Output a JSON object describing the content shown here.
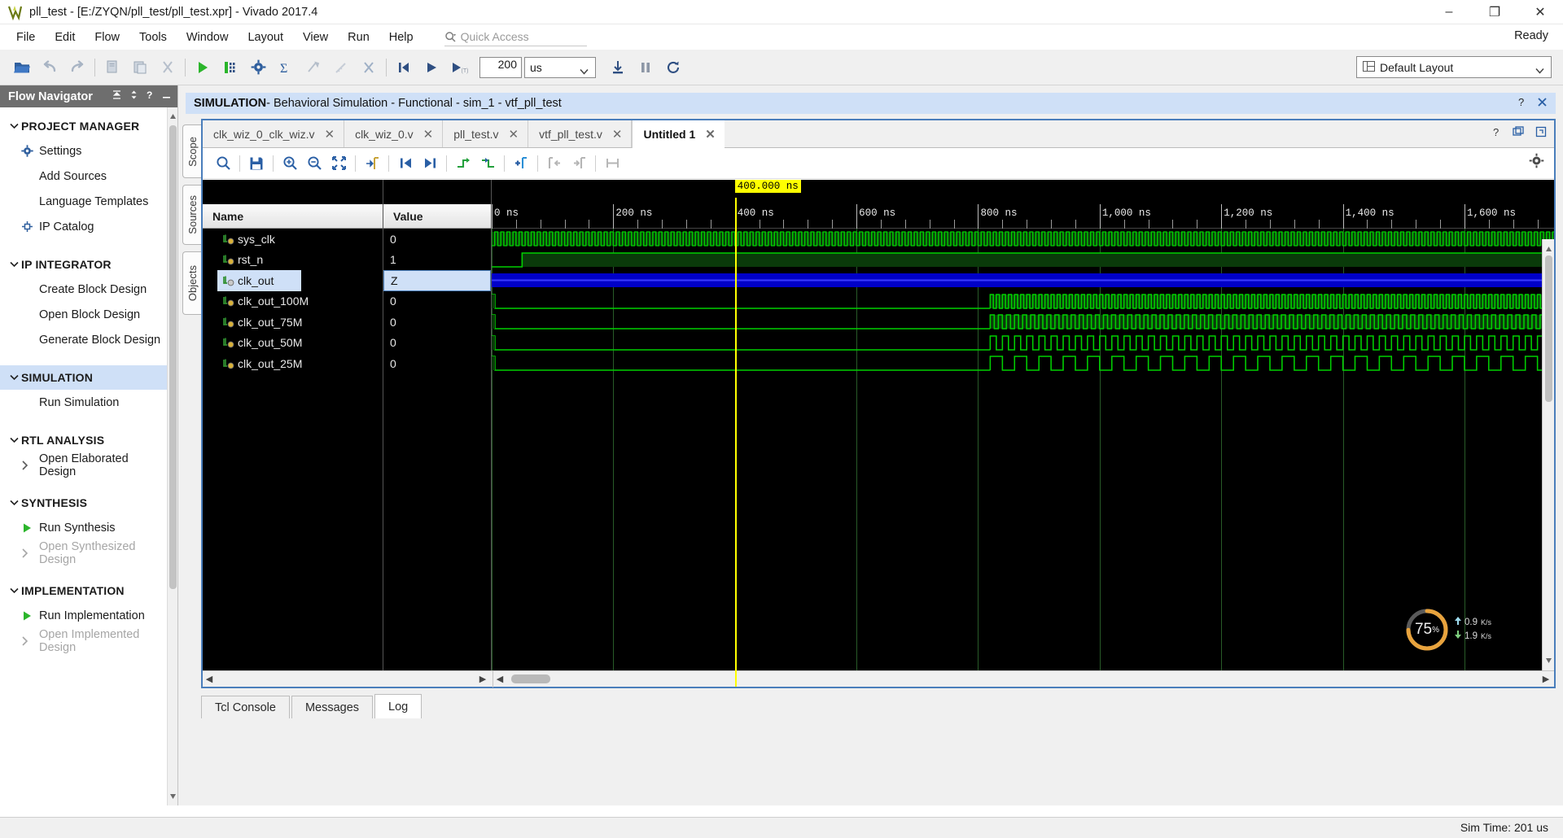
{
  "window": {
    "title": "pll_test - [E:/ZYQN/pll_test/pll_test.xpr] - Vivado 2017.4",
    "minimize": "–",
    "maximize": "❐",
    "close": "✕"
  },
  "menu": {
    "items": [
      {
        "label": "File"
      },
      {
        "label": "Edit"
      },
      {
        "label": "Flow"
      },
      {
        "label": "Tools"
      },
      {
        "label": "Window"
      },
      {
        "label": "Layout"
      },
      {
        "label": "View"
      },
      {
        "label": "Run"
      },
      {
        "label": "Help"
      }
    ],
    "quick_access_placeholder": "Quick Access",
    "ready_label": "Ready"
  },
  "toolbar": {
    "sim_time_value": "200",
    "sim_time_unit": "us",
    "layout_label": "Default Layout"
  },
  "flow_navigator": {
    "title": "Flow Navigator",
    "sections": [
      {
        "label": "PROJECT MANAGER",
        "active": false,
        "items": [
          {
            "label": "Settings",
            "icon": "gear-icon",
            "disabled": false,
            "arrow": false
          },
          {
            "label": "Add Sources",
            "icon": "none",
            "disabled": false,
            "arrow": false
          },
          {
            "label": "Language Templates",
            "icon": "none",
            "disabled": false,
            "arrow": false
          },
          {
            "label": "IP Catalog",
            "icon": "ip-icon",
            "disabled": false,
            "arrow": false
          }
        ]
      },
      {
        "label": "IP INTEGRATOR",
        "active": false,
        "items": [
          {
            "label": "Create Block Design",
            "icon": "none",
            "disabled": false,
            "arrow": false
          },
          {
            "label": "Open Block Design",
            "icon": "none",
            "disabled": false,
            "arrow": false
          },
          {
            "label": "Generate Block Design",
            "icon": "none",
            "disabled": false,
            "arrow": false
          }
        ]
      },
      {
        "label": "SIMULATION",
        "active": true,
        "items": [
          {
            "label": "Run Simulation",
            "icon": "none",
            "disabled": false,
            "arrow": false
          }
        ]
      },
      {
        "label": "RTL ANALYSIS",
        "active": false,
        "items": [
          {
            "label": "Open Elaborated Design",
            "icon": "none",
            "disabled": false,
            "arrow": true
          }
        ]
      },
      {
        "label": "SYNTHESIS",
        "active": false,
        "items": [
          {
            "label": "Run Synthesis",
            "icon": "play-icon",
            "disabled": false,
            "arrow": false
          },
          {
            "label": "Open Synthesized Design",
            "icon": "none",
            "disabled": true,
            "arrow": true
          }
        ]
      },
      {
        "label": "IMPLEMENTATION",
        "active": false,
        "items": [
          {
            "label": "Run Implementation",
            "icon": "play-icon",
            "disabled": false,
            "arrow": false
          },
          {
            "label": "Open Implemented Design",
            "icon": "none",
            "disabled": true,
            "arrow": true
          }
        ]
      }
    ]
  },
  "simulation": {
    "header_bold": "SIMULATION",
    "header_rest": " - Behavioral Simulation - Functional - sim_1 - vtf_pll_test",
    "side_tabs": [
      "Scope",
      "Sources",
      "Objects"
    ],
    "file_tabs": [
      {
        "label": "clk_wiz_0_clk_wiz.v",
        "active": false
      },
      {
        "label": "clk_wiz_0.v",
        "active": false
      },
      {
        "label": "pll_test.v",
        "active": false
      },
      {
        "label": "vtf_pll_test.v",
        "active": false
      },
      {
        "label": "Untitled 1",
        "active": true
      }
    ],
    "close_glyph": "✕",
    "columns": {
      "name": "Name",
      "value": "Value"
    },
    "signals": [
      {
        "name": "sys_clk",
        "value": "0",
        "selected": false,
        "wave": "clock",
        "period": 10,
        "start": 0,
        "color": "#00d000"
      },
      {
        "name": "rst_n",
        "value": "1",
        "selected": false,
        "wave": "reset",
        "rise_at": 50,
        "color": "#00d000"
      },
      {
        "name": "clk_out",
        "value": "Z",
        "selected": true,
        "wave": "highz",
        "color": "#0000ff"
      },
      {
        "name": "clk_out_100M",
        "value": "0",
        "selected": false,
        "wave": "gated",
        "period": 10,
        "lock_at": 820,
        "color": "#00d000"
      },
      {
        "name": "clk_out_75M",
        "value": "0",
        "selected": false,
        "wave": "gated",
        "period": 13.3,
        "lock_at": 820,
        "color": "#00d000"
      },
      {
        "name": "clk_out_50M",
        "value": "0",
        "selected": false,
        "wave": "gated",
        "period": 20,
        "lock_at": 820,
        "color": "#00d000"
      },
      {
        "name": "clk_out_25M",
        "value": "0",
        "selected": false,
        "wave": "gated",
        "period": 40,
        "lock_at": 820,
        "color": "#00d000"
      }
    ],
    "marker": {
      "label": "400.000 ns",
      "time_ns": 400
    },
    "ruler": {
      "ticks": [
        {
          "label": "0 ns",
          "time_ns": 0
        },
        {
          "label": "200 ns",
          "time_ns": 200
        },
        {
          "label": "400 ns",
          "time_ns": 400
        },
        {
          "label": "600 ns",
          "time_ns": 600
        },
        {
          "label": "800 ns",
          "time_ns": 800
        },
        {
          "label": "1,000 ns",
          "time_ns": 1000
        },
        {
          "label": "1,200 ns",
          "time_ns": 1200
        },
        {
          "label": "1,400 ns",
          "time_ns": 1400
        },
        {
          "label": "1,600 ns",
          "time_ns": 1600
        }
      ],
      "range_ns": [
        0,
        1750
      ]
    },
    "progress": {
      "percent": "75",
      "percent_unit": "%",
      "up_rate": "0.9",
      "up_unit": "K/s",
      "down_rate": "1.9",
      "down_unit": "K/s"
    }
  },
  "console": {
    "tabs": [
      {
        "label": "Tcl Console",
        "active": false
      },
      {
        "label": "Messages",
        "active": false
      },
      {
        "label": "Log",
        "active": true
      }
    ]
  },
  "status": {
    "sim_time": "Sim Time: 201 us"
  },
  "colors": {
    "accent_blue": "#4a7ebb",
    "select_blue": "#cfe0f7",
    "wave_green": "#00d000",
    "wave_highz": "#0000ff",
    "marker_yellow": "#ffff00",
    "header_gray": "#6e6e6e"
  }
}
